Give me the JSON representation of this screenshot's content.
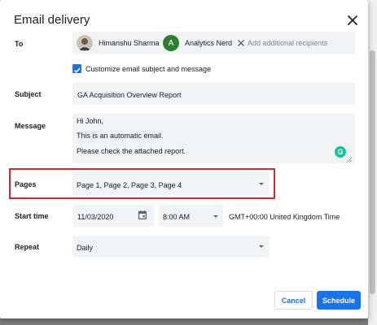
{
  "dialog": {
    "title": "Email delivery",
    "close_icon": "close-icon"
  },
  "to": {
    "label": "To",
    "recipients": [
      {
        "name": "Himanshu Sharma",
        "avatar": "photo"
      },
      {
        "name": "Analytics Nerd",
        "initial": "A",
        "avatar_color": "#2e7d32"
      }
    ],
    "placeholder": "Add additional recipients"
  },
  "customize": {
    "label": "Customize email subject and message",
    "checked": true
  },
  "subject": {
    "label": "Subject",
    "value": "GA Acquisition Overview Report"
  },
  "message": {
    "label": "Message",
    "lines": [
      "Hi John,",
      "This is an automatic email.",
      "Please check the attached report."
    ],
    "grammarly_letter": "G"
  },
  "pages": {
    "label": "Pages",
    "value": "Page 1, Page 2, Page 3, Page 4"
  },
  "start_time": {
    "label": "Start time",
    "date": "11/03/2020",
    "time": "8:00 AM",
    "timezone": "GMT+00:00 United Kingdom Time"
  },
  "repeat": {
    "label": "Repeat",
    "value": "Daily"
  },
  "buttons": {
    "cancel": "Cancel",
    "schedule": "Schedule"
  },
  "colors": {
    "primary": "#1a73e8",
    "highlight": "#d7262d",
    "field_bg": "#f1f3f4"
  }
}
